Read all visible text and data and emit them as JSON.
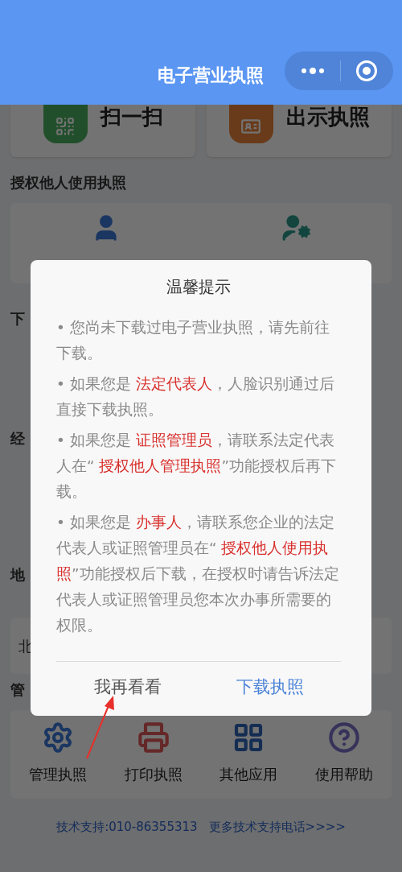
{
  "header": {
    "title": "电子营业执照"
  },
  "quick_actions": [
    {
      "label": "扫一扫"
    },
    {
      "label": "出示执照"
    }
  ],
  "authorize_section": {
    "title": "授权他人使用执照"
  },
  "section_titles": [
    "下",
    "经",
    "地"
  ],
  "region_value": "北",
  "manage_section": {
    "title": "管",
    "items": [
      {
        "label": "管理执照"
      },
      {
        "label": "打印执照"
      },
      {
        "label": "其他应用"
      },
      {
        "label": "使用帮助"
      }
    ]
  },
  "footer": {
    "support": "技术支持:010-86355313",
    "more_link": "更多技术支持电话>>>>"
  },
  "dialog": {
    "title": "温馨提示",
    "bullet": "•",
    "paragraphs": [
      [
        {
          "text": "您尚未下载过电子营业执照，请先前往下载。",
          "highlight": false
        }
      ],
      [
        {
          "text": "如果您是 ",
          "highlight": false
        },
        {
          "text": "法定代表人",
          "highlight": true
        },
        {
          "text": "，人脸识别通过后直接下载执照。",
          "highlight": false
        }
      ],
      [
        {
          "text": "如果您是 ",
          "highlight": false
        },
        {
          "text": "证照管理员",
          "highlight": true
        },
        {
          "text": "，请联系法定代表人在“ ",
          "highlight": false
        },
        {
          "text": "授权他人管理执照",
          "highlight": true
        },
        {
          "text": "”功能授权后再下载。",
          "highlight": false
        }
      ],
      [
        {
          "text": "如果您是 ",
          "highlight": false
        },
        {
          "text": "办事人",
          "highlight": true
        },
        {
          "text": "，请联系您企业的法定代表人或证照管理员在“ ",
          "highlight": false
        },
        {
          "text": "授权他人使用执照",
          "highlight": true
        },
        {
          "text": "”功能授权后下载，在授权时请告诉法定代表人或证照管理员您本次办事所需要的权限。",
          "highlight": false
        }
      ]
    ],
    "buttons": [
      {
        "label": "我再看看",
        "primary": false
      },
      {
        "label": "下载执照",
        "primary": true
      }
    ]
  }
}
